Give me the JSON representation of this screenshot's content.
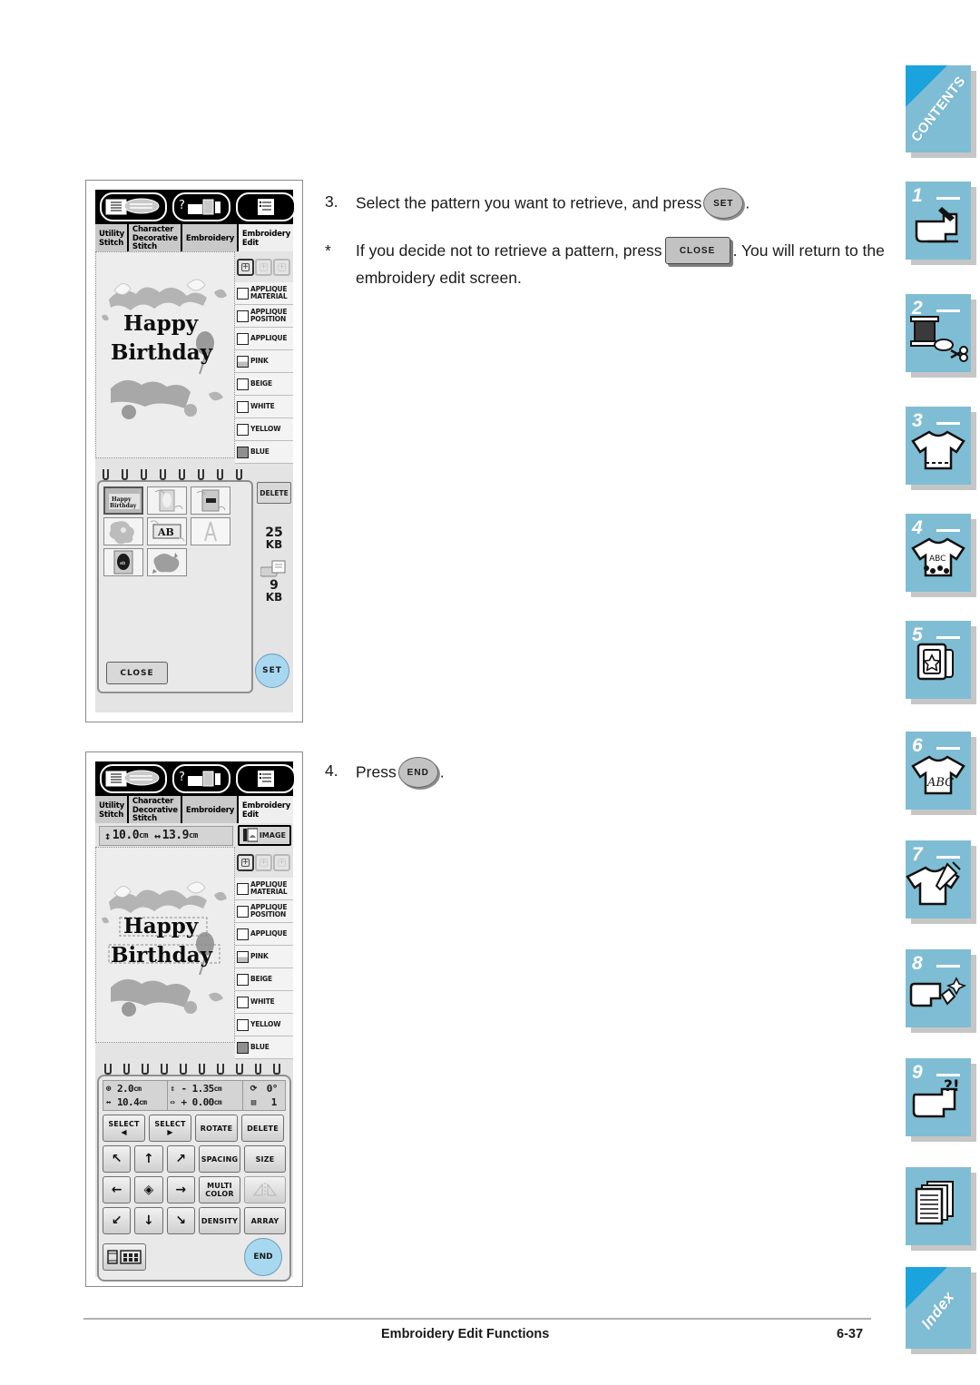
{
  "page": {
    "footer_title": "Embroidery Edit Functions",
    "footer_page": "6-37"
  },
  "steps": [
    {
      "mark": "3.",
      "text_before": "Select the pattern you want to retrieve, and press",
      "button": "SET",
      "text_after": "."
    },
    {
      "mark": "*",
      "text_before": "If you decide not to retrieve a pattern, press",
      "button": "CLOSE",
      "text_after": ". You will return to the embroidery edit screen."
    },
    {
      "mark": "4.",
      "text_before": "Press",
      "button": "END",
      "text_after": "."
    }
  ],
  "screen1": {
    "top_icons": [
      "manual-book-icon",
      "help-machine-icon",
      "settings-list-icon"
    ],
    "tabs": [
      {
        "label": "Utility\nStitch",
        "selected": false
      },
      {
        "label": "Character\nDecorative\nStitch",
        "selected": false
      },
      {
        "label": "Embroidery",
        "selected": false
      },
      {
        "label": "Embroidery\nEdit",
        "selected": true
      }
    ],
    "design_text_line1": "Happy",
    "design_text_line2": "Birthday",
    "hoops": [
      "hoop-large-selected",
      "hoop-medium",
      "hoop-small"
    ],
    "color_list": [
      {
        "name": "APPLIQUE\nMATERIAL",
        "swatch": "outline"
      },
      {
        "name": "APPLIQUE\nPOSITION",
        "swatch": "outline"
      },
      {
        "name": "APPLIQUE",
        "swatch": "outline"
      },
      {
        "name": "PINK",
        "swatch": "half"
      },
      {
        "name": "BEIGE",
        "swatch": "outline"
      },
      {
        "name": "WHITE",
        "swatch": "outline"
      },
      {
        "name": "YELLOW",
        "swatch": "outline"
      },
      {
        "name": "BLUE",
        "swatch": "fill"
      }
    ],
    "thumbnails": [
      {
        "name": "happy-birthday-pattern",
        "selected": true,
        "caption": "Happy Birthday"
      },
      {
        "name": "frame-pattern-2",
        "selected": false,
        "caption": ""
      },
      {
        "name": "frame-pattern-3",
        "selected": false,
        "caption": ""
      },
      {
        "name": "floral-pattern-4",
        "selected": false,
        "caption": ""
      },
      {
        "name": "ab-pattern-5",
        "selected": false,
        "caption": "AB"
      },
      {
        "name": "letter-a-pattern-6",
        "selected": false,
        "caption": ""
      },
      {
        "name": "oval-frame-pattern-7",
        "selected": false,
        "caption": ""
      },
      {
        "name": "floral-pattern-8",
        "selected": false,
        "caption": ""
      }
    ],
    "delete_label": "DELETE",
    "memory_machine": "25",
    "memory_machine_unit": "KB",
    "memory_card": "9",
    "memory_card_unit": "KB",
    "close_label": "CLOSE",
    "set_label": "SET"
  },
  "screen2": {
    "tabs": [
      {
        "label": "Utility\nStitch",
        "selected": false
      },
      {
        "label": "Character\nDecorative\nStitch",
        "selected": false
      },
      {
        "label": "Embroidery",
        "selected": false
      },
      {
        "label": "Embroidery\nEdit",
        "selected": true
      }
    ],
    "size_height": "10.0",
    "size_height_unit": "cm",
    "size_width": "13.9",
    "size_width_unit": "cm",
    "image_label": "IMAGE",
    "design_text_line1": "Happy",
    "design_text_line2": "Birthday",
    "color_list": [
      {
        "name": "APPLIQUE\nMATERIAL",
        "swatch": "outline"
      },
      {
        "name": "APPLIQUE\nPOSITION",
        "swatch": "outline"
      },
      {
        "name": "APPLIQUE",
        "swatch": "outline"
      },
      {
        "name": "PINK",
        "swatch": "half"
      },
      {
        "name": "BEIGE",
        "swatch": "outline"
      },
      {
        "name": "WHITE",
        "swatch": "outline"
      },
      {
        "name": "YELLOW",
        "swatch": "outline"
      },
      {
        "name": "BLUE",
        "swatch": "fill"
      }
    ],
    "readout": {
      "pos_v": "2.0",
      "pos_v_unit": "cm",
      "pos_h": "10.4",
      "pos_h_unit": "cm",
      "spacing_v": "- 1.35",
      "spacing_v_unit": "cm",
      "spacing_h": "+ 0.00",
      "spacing_h_unit": "cm",
      "rotation": "0°",
      "array": "1"
    },
    "buttons": {
      "select_prev": "SELECT\n◀",
      "select_next": "SELECT\n▶",
      "rotate": "ROTATE",
      "delete": "DELETE",
      "spacing": "SPACING",
      "size": "SIZE",
      "multi_color": "MULTI\nCOLOR",
      "mirror": "",
      "density": "DENSITY",
      "array": "ARRAY",
      "end": "END",
      "arrows": [
        "↖",
        "↑",
        "↗",
        "←",
        "◈",
        "→",
        "↙",
        "↓",
        "↘"
      ],
      "thread_palette": "thread-palette-icon"
    }
  },
  "rail": {
    "tabs": [
      {
        "num": "",
        "label": "CONTENTS",
        "corner": true,
        "icon": ""
      },
      {
        "num": "1",
        "label": "",
        "corner": false,
        "icon": "sewing-machine-icon"
      },
      {
        "num": "2",
        "label": "",
        "corner": false,
        "icon": "thread-spool-scissors-icon"
      },
      {
        "num": "3",
        "label": "",
        "corner": false,
        "icon": "shirt-stitch-icon"
      },
      {
        "num": "4",
        "label": "",
        "corner": false,
        "icon": "shirt-abc-icon"
      },
      {
        "num": "5",
        "label": "",
        "corner": false,
        "icon": "embroidery-card-star-icon"
      },
      {
        "num": "6",
        "label": "",
        "corner": false,
        "icon": "shirt-letters-icon"
      },
      {
        "num": "7",
        "label": "",
        "corner": false,
        "icon": "shirt-needle-icon"
      },
      {
        "num": "8",
        "label": "",
        "corner": false,
        "icon": "machine-maintenance-icon"
      },
      {
        "num": "9",
        "label": "",
        "corner": false,
        "icon": "machine-troubleshoot-icon"
      },
      {
        "num": "",
        "label": "",
        "corner": false,
        "icon": "pages-stack-icon"
      },
      {
        "num": "",
        "label": "Index",
        "corner": true,
        "icon": ""
      }
    ]
  },
  "colors": {
    "rail_tab": "#7fbdd4",
    "rail_corner": "#1ba3dd",
    "rail_shadow": "#c6c6c6",
    "lcd_bg": "#e4e4e4",
    "button_blue": "#a8d8f0",
    "text": "#1a1a1a"
  }
}
